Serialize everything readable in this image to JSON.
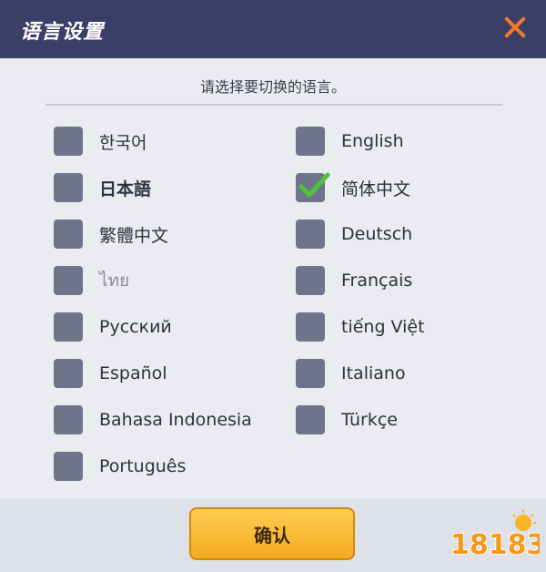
{
  "header": {
    "title": "语言设置"
  },
  "instruction": "请选择要切换的语言。",
  "languages": [
    {
      "label": "한국어",
      "checked": false
    },
    {
      "label": "English",
      "checked": false
    },
    {
      "label": "日本語",
      "checked": false
    },
    {
      "label": "简体中文",
      "checked": true
    },
    {
      "label": "繁體中文",
      "checked": false
    },
    {
      "label": "Deutsch",
      "checked": false
    },
    {
      "label": "ไทย",
      "checked": false
    },
    {
      "label": "Français",
      "checked": false
    },
    {
      "label": "Русский",
      "checked": false
    },
    {
      "label": "tiếng Việt",
      "checked": false
    },
    {
      "label": "Español",
      "checked": false
    },
    {
      "label": "Italiano",
      "checked": false
    },
    {
      "label": "Bahasa Indonesia",
      "checked": false
    },
    {
      "label": "Türkçe",
      "checked": false
    },
    {
      "label": "Português",
      "checked": false
    }
  ],
  "footer": {
    "confirm_label": "确认"
  },
  "watermark": {
    "text": "18183"
  },
  "colors": {
    "header": "#3b3f67",
    "close": "#f0792a",
    "checkbox": "#70748a",
    "check": "#4cc53a",
    "button": "#f4a91e"
  }
}
